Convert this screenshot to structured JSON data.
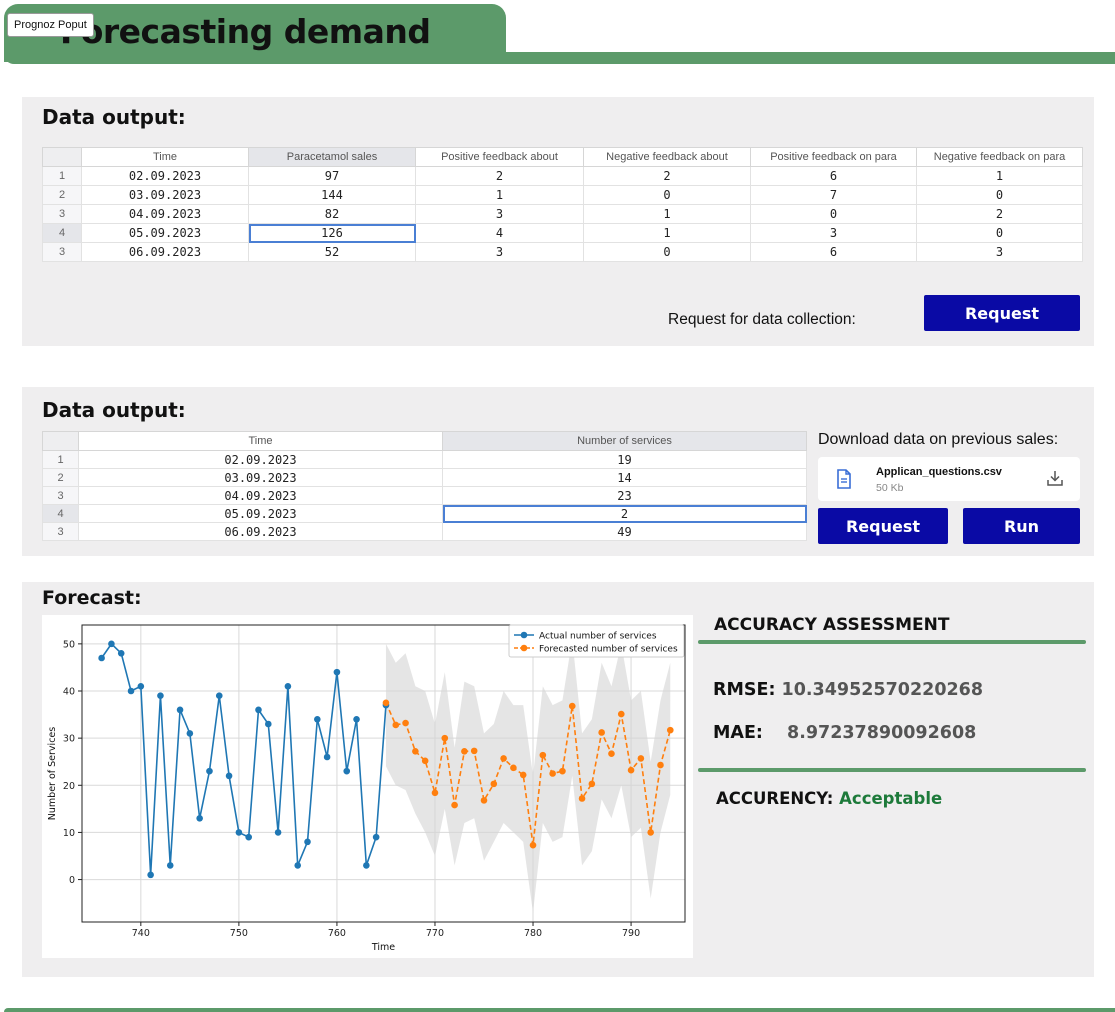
{
  "header": {
    "title": "Forecasting demand",
    "popup_label": "Prognoz Poput"
  },
  "section1": {
    "title": "Data output:",
    "columns": [
      "Time",
      "Paracetamol sales",
      "Positive feedback about",
      "Negative feedback about",
      "Positive feedback on para",
      "Negative feedback on para"
    ],
    "rows": [
      {
        "idx": "1",
        "cells": [
          "02.09.2023",
          "97",
          "2",
          "2",
          "6",
          "1"
        ]
      },
      {
        "idx": "2",
        "cells": [
          "03.09.2023",
          "144",
          "1",
          "0",
          "7",
          "0"
        ]
      },
      {
        "idx": "3",
        "cells": [
          "04.09.2023",
          "82",
          "3",
          "1",
          "0",
          "2"
        ]
      },
      {
        "idx": "4",
        "cells": [
          "05.09.2023",
          "126",
          "4",
          "1",
          "3",
          "0"
        ]
      },
      {
        "idx": "3",
        "cells": [
          "06.09.2023",
          "52",
          "3",
          "0",
          "6",
          "3"
        ]
      }
    ],
    "request_label": "Request for data collection:",
    "request_button": "Request"
  },
  "section2": {
    "title": "Data output:",
    "columns": [
      "Time",
      "Number of services"
    ],
    "rows": [
      {
        "idx": "1",
        "cells": [
          "02.09.2023",
          "19"
        ]
      },
      {
        "idx": "2",
        "cells": [
          "03.09.2023",
          "14"
        ]
      },
      {
        "idx": "3",
        "cells": [
          "04.09.2023",
          "23"
        ]
      },
      {
        "idx": "4",
        "cells": [
          "05.09.2023",
          "2"
        ]
      },
      {
        "idx": "3",
        "cells": [
          "06.09.2023",
          "49"
        ]
      }
    ],
    "download_title": "Download data on previous sales:",
    "file": {
      "name": "Applican_questions.csv",
      "size": "50 Kb"
    },
    "request_button": "Request",
    "run_button": "Run"
  },
  "forecast": {
    "title": "Forecast:",
    "accuracy_title": "ACCURACY ASSESSMENT",
    "rmse_label": "RMSE:",
    "rmse_value": "10.34952570220268",
    "mae_label": "MAE:",
    "mae_value": "8.97237890092608",
    "accurency_label": "ACCURENCY:",
    "accurency_value": "Acceptable"
  },
  "colors": {
    "brand_green": "#5c9a6a",
    "button_blue": "#0a0aa5",
    "actual_series": "#1f77b4",
    "forecast_series": "#ff7f0e",
    "acceptable": "#1d7a3a"
  },
  "chart_data": {
    "type": "line",
    "xlabel": "Time",
    "ylabel": "Number of Services",
    "xlim": [
      734,
      795.5
    ],
    "ylim": [
      -9,
      54
    ],
    "xticks": [
      740,
      750,
      760,
      770,
      780,
      790
    ],
    "yticks": [
      0,
      10,
      20,
      30,
      40,
      50
    ],
    "grid": true,
    "legend": "top-right",
    "series": [
      {
        "name": "Actual number of services",
        "style": "solid",
        "color": "#1f77b4",
        "x": [
          736,
          737,
          738,
          739,
          740,
          741,
          742,
          743,
          744,
          745,
          746,
          747,
          748,
          749,
          750,
          751,
          752,
          753,
          754,
          755,
          756,
          757,
          758,
          759,
          760,
          761,
          762,
          763,
          764,
          765
        ],
        "y": [
          47,
          50,
          48,
          40,
          41,
          1,
          39,
          3,
          36,
          31,
          13,
          23,
          39,
          22,
          10,
          9,
          36,
          33,
          10,
          41,
          3,
          8,
          34,
          26,
          44,
          23,
          34,
          3,
          9,
          37
        ]
      },
      {
        "name": "Forecasted number of services",
        "style": "dashed",
        "color": "#ff7f0e",
        "x": [
          765,
          766,
          767,
          768,
          769,
          770,
          771,
          772,
          773,
          774,
          775,
          776,
          777,
          778,
          779,
          780,
          781,
          782,
          783,
          784,
          785,
          786,
          787,
          788,
          789,
          790,
          791,
          792,
          793,
          794
        ],
        "y": [
          37.5,
          32.8,
          33.2,
          27.2,
          25.2,
          18.4,
          30,
          15.8,
          27.2,
          27.3,
          16.8,
          20.3,
          25.7,
          23.7,
          22.2,
          7.3,
          26.4,
          22.5,
          23,
          36.8,
          17.2,
          20.3,
          31.2,
          26.7,
          35.1,
          23.2,
          25.7,
          10,
          24.3,
          31.7
        ]
      }
    ],
    "confidence_band": {
      "x": [
        765,
        766,
        767,
        768,
        769,
        770,
        771,
        772,
        773,
        774,
        775,
        776,
        777,
        778,
        779,
        780,
        781,
        782,
        783,
        784,
        785,
        786,
        787,
        788,
        789,
        790,
        791,
        792,
        793,
        794
      ],
      "lower": [
        24,
        20,
        19,
        14,
        10,
        5,
        15,
        3,
        12,
        13,
        4,
        8,
        12,
        10,
        8,
        -7,
        12,
        8,
        9,
        22,
        3,
        6,
        17,
        13,
        20,
        9,
        11,
        -4,
        10,
        18
      ],
      "upper": [
        50,
        46,
        48,
        41,
        40,
        33,
        44,
        28,
        42,
        41,
        31,
        33,
        40,
        37,
        37,
        22,
        41,
        37,
        38,
        51,
        31,
        34,
        46,
        41,
        50,
        38,
        40,
        25,
        38,
        46
      ]
    }
  }
}
